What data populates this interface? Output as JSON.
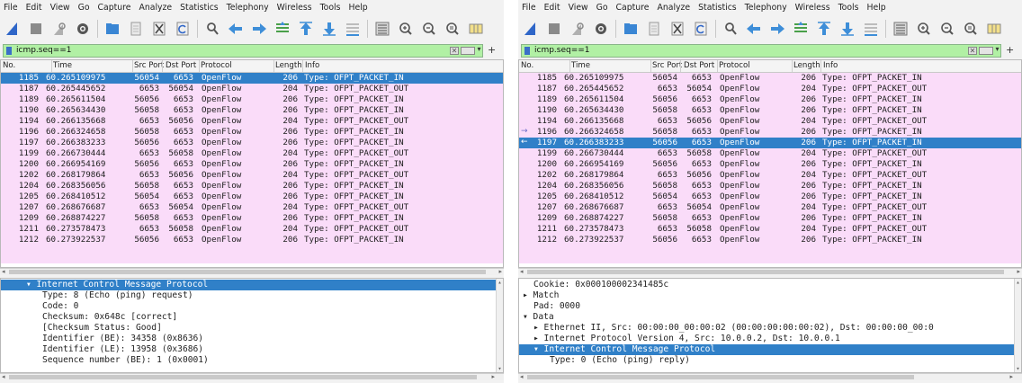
{
  "menu": [
    "File",
    "Edit",
    "View",
    "Go",
    "Capture",
    "Analyze",
    "Statistics",
    "Telephony",
    "Wireless",
    "Tools",
    "Help"
  ],
  "toolbar_icons": [
    "shark-fin-start-icon",
    "stop-square-icon",
    "restart-fin-icon",
    "options-gear-icon",
    "open-folder-icon",
    "file-icon",
    "close-file-icon",
    "reload-icon",
    "find-magnifier-icon",
    "go-back-arrow-icon",
    "go-forward-arrow-icon",
    "go-to-packet-icon",
    "go-first-icon",
    "go-last-icon",
    "autoscroll-icon",
    "colorize-icon",
    "zoom-in-icon",
    "zoom-out-icon",
    "zoom-normal-icon",
    "resize-columns-icon"
  ],
  "filter": {
    "value": "icmp.seq==1",
    "plus": "+"
  },
  "columns": {
    "no": "No.",
    "time": "Time",
    "src_port": "Src Port",
    "dst_port": "Dst Port",
    "protocol": "Protocol",
    "length": "Length",
    "info": "Info"
  },
  "colors": {
    "row_bg": "#fadcf9",
    "selected": "#3080c8",
    "filter_bg": "#b1f0a4"
  },
  "packets": [
    {
      "no": "1185",
      "time": "60.265109975",
      "src": "56054",
      "dst": "6653",
      "proto": "OpenFlow",
      "len": "206",
      "info": "Type: OFPT_PACKET_IN"
    },
    {
      "no": "1187",
      "time": "60.265445652",
      "src": "6653",
      "dst": "56054",
      "proto": "OpenFlow",
      "len": "204",
      "info": "Type: OFPT_PACKET_OUT"
    },
    {
      "no": "1189",
      "time": "60.265611504",
      "src": "56056",
      "dst": "6653",
      "proto": "OpenFlow",
      "len": "206",
      "info": "Type: OFPT_PACKET_IN"
    },
    {
      "no": "1190",
      "time": "60.265634430",
      "src": "56058",
      "dst": "6653",
      "proto": "OpenFlow",
      "len": "206",
      "info": "Type: OFPT_PACKET_IN"
    },
    {
      "no": "1194",
      "time": "60.266135668",
      "src": "6653",
      "dst": "56056",
      "proto": "OpenFlow",
      "len": "204",
      "info": "Type: OFPT_PACKET_OUT"
    },
    {
      "no": "1196",
      "time": "60.266324658",
      "src": "56058",
      "dst": "6653",
      "proto": "OpenFlow",
      "len": "206",
      "info": "Type: OFPT_PACKET_IN"
    },
    {
      "no": "1197",
      "time": "60.266383233",
      "src": "56056",
      "dst": "6653",
      "proto": "OpenFlow",
      "len": "206",
      "info": "Type: OFPT_PACKET_IN"
    },
    {
      "no": "1199",
      "time": "60.266730444",
      "src": "6653",
      "dst": "56058",
      "proto": "OpenFlow",
      "len": "204",
      "info": "Type: OFPT_PACKET_OUT"
    },
    {
      "no": "1200",
      "time": "60.266954169",
      "src": "56056",
      "dst": "6653",
      "proto": "OpenFlow",
      "len": "206",
      "info": "Type: OFPT_PACKET_IN"
    },
    {
      "no": "1202",
      "time": "60.268179864",
      "src": "6653",
      "dst": "56056",
      "proto": "OpenFlow",
      "len": "204",
      "info": "Type: OFPT_PACKET_OUT"
    },
    {
      "no": "1204",
      "time": "60.268356056",
      "src": "56058",
      "dst": "6653",
      "proto": "OpenFlow",
      "len": "206",
      "info": "Type: OFPT_PACKET_IN"
    },
    {
      "no": "1205",
      "time": "60.268410512",
      "src": "56054",
      "dst": "6653",
      "proto": "OpenFlow",
      "len": "206",
      "info": "Type: OFPT_PACKET_IN"
    },
    {
      "no": "1207",
      "time": "60.268676687",
      "src": "6653",
      "dst": "56054",
      "proto": "OpenFlow",
      "len": "204",
      "info": "Type: OFPT_PACKET_OUT"
    },
    {
      "no": "1209",
      "time": "60.268874227",
      "src": "56058",
      "dst": "6653",
      "proto": "OpenFlow",
      "len": "206",
      "info": "Type: OFPT_PACKET_IN"
    },
    {
      "no": "1211",
      "time": "60.273578473",
      "src": "6653",
      "dst": "56058",
      "proto": "OpenFlow",
      "len": "204",
      "info": "Type: OFPT_PACKET_OUT"
    },
    {
      "no": "1212",
      "time": "60.273922537",
      "src": "56056",
      "dst": "6653",
      "proto": "OpenFlow",
      "len": "206",
      "info": "Type: OFPT_PACKET_IN"
    }
  ],
  "left": {
    "selected_packet": "1185",
    "details": [
      {
        "text": "▾ Internet Control Message Protocol",
        "indent": 4,
        "selected": true
      },
      {
        "text": "Type: 8 (Echo (ping) request)",
        "indent": 7
      },
      {
        "text": "Code: 0",
        "indent": 7
      },
      {
        "text": "Checksum: 0x648c [correct]",
        "indent": 7
      },
      {
        "text": "[Checksum Status: Good]",
        "indent": 7
      },
      {
        "text": "Identifier (BE): 34358 (0x8636)",
        "indent": 7
      },
      {
        "text": "Identifier (LE): 13958 (0x3686)",
        "indent": 7
      },
      {
        "text": "Sequence number (BE): 1 (0x0001)",
        "indent": 7
      }
    ]
  },
  "right": {
    "selected_packet": "1197",
    "details": [
      {
        "text": "Cookie: 0x000100002341485c",
        "indent": 2
      },
      {
        "text": "▸ Match",
        "indent": 0
      },
      {
        "text": "Pad: 0000",
        "indent": 2
      },
      {
        "text": "▾ Data",
        "indent": 0
      },
      {
        "text": "▸ Ethernet II, Src: 00:00:00_00:00:02 (00:00:00:00:00:02), Dst: 00:00:00_00:0",
        "indent": 2
      },
      {
        "text": "▸ Internet Protocol Version 4, Src: 10.0.0.2, Dst: 10.0.0.1",
        "indent": 2
      },
      {
        "text": "▾ Internet Control Message Protocol",
        "indent": 2,
        "selected": true
      },
      {
        "text": "Type: 0 (Echo (ping) reply)",
        "indent": 5
      }
    ]
  }
}
